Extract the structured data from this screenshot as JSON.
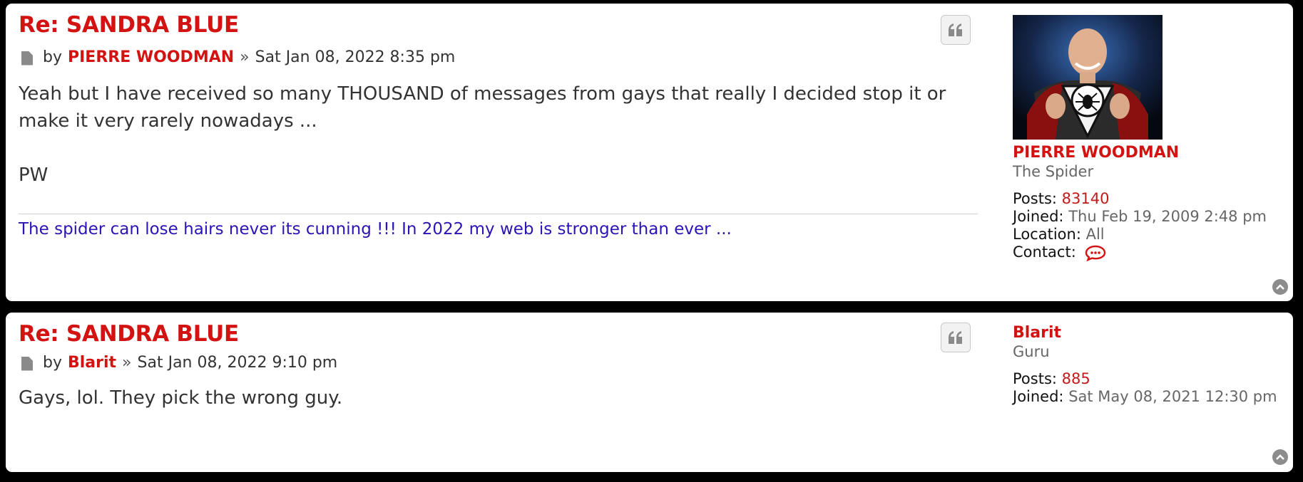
{
  "posts": [
    {
      "title": "Re: SANDRA BLUE",
      "by_label": "by",
      "author": "PIERRE WOODMAN",
      "separator": "»",
      "date": "Sat Jan 08, 2022 8:35 pm",
      "content": [
        "Yeah but I have received so many THOUSAND of messages from gays that really I decided stop it or make it very rarely nowadays ...",
        "",
        "PW"
      ],
      "signature": "The spider can lose hairs never its cunning !!! In 2022 my web is stronger than ever ...",
      "profile": {
        "avatar": "spider-superhero-avatar",
        "name": "PIERRE WOODMAN",
        "rank": "The Spider",
        "posts_label": "Posts:",
        "posts": "83140",
        "joined_label": "Joined:",
        "joined": "Thu Feb 19, 2009 2:48 pm",
        "location_label": "Location:",
        "location": "All",
        "contact_label": "Contact:",
        "contact_icon": "speech-bubble-icon"
      }
    },
    {
      "title": "Re: SANDRA BLUE",
      "by_label": "by",
      "author": "Blarit",
      "separator": "»",
      "date": "Sat Jan 08, 2022 9:10 pm",
      "content": [
        "Gays, lol. They pick the wrong guy."
      ],
      "profile": {
        "name": "Blarit",
        "rank": "Guru",
        "posts_label": "Posts:",
        "posts": "885",
        "joined_label": "Joined:",
        "joined": "Sat May 08, 2021 12:30 pm"
      }
    }
  ],
  "icons": {
    "quote": "quote-icon",
    "post": "post-file-icon",
    "back_to_top": "chevron-up-circle-icon"
  },
  "colors": {
    "accent_red": "#d31212",
    "signature_blue": "#2a14b5",
    "page_bg": "#000000",
    "post_bg": "#ffffff"
  }
}
